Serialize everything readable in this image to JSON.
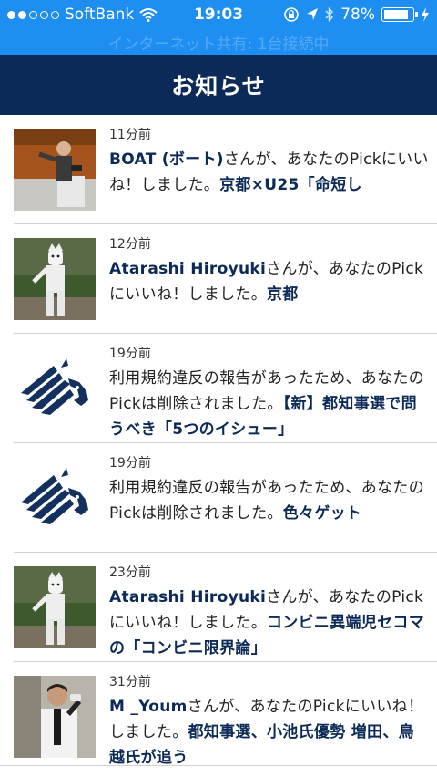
{
  "status": {
    "carrier": "SoftBank",
    "time": "19:03",
    "battery": "78%",
    "tether": "インターネット共有: 1台接続中"
  },
  "header": {
    "title": "お知らせ"
  },
  "notifications": [
    {
      "time": "11分前",
      "name": "BOAT (ボート)",
      "text": "さんが、あなたのPickにいいね！しました。",
      "pick": "京都×U25「命短し"
    },
    {
      "time": "12分前",
      "name": "Atarashi Hiroyuki",
      "text": "さんが、あなたのPickにいいね！しました。",
      "pick": "京都"
    },
    {
      "time": "19分前",
      "name": "",
      "text": "利用規約違反の報告があったため、あなたのPickは削除されました。",
      "pick": "【新】都知事選で問うべき「5つのイシュー」"
    },
    {
      "time": "19分前",
      "name": "",
      "text": "利用規約違反の報告があったため、あなたのPickは削除されました。",
      "pick": "色々ゲット"
    },
    {
      "time": "23分前",
      "name": "Atarashi Hiroyuki",
      "text": "さんが、あなたのPickにいいね！しました。",
      "pick": "コンビニ異端児セコマの「コンビニ限界論」"
    },
    {
      "time": "31分前",
      "name": "M _Youm",
      "text": "さんが、あなたのPickにいいね！しました。",
      "pick": "都知事選、小池氏優勢 増田、鳥越氏が追う"
    }
  ],
  "colors": {
    "status_bar": "#1f8ef1",
    "nav_bar": "#0c2a57",
    "link": "#0c2a57"
  },
  "icons": {
    "wifi": "wifi-icon",
    "orientation_lock": "orientation-lock-icon",
    "location": "location-arrow-icon",
    "bluetooth": "bluetooth-icon",
    "battery": "battery-icon",
    "charging": "charging-icon",
    "system_logo": "zebra-logo-icon"
  }
}
